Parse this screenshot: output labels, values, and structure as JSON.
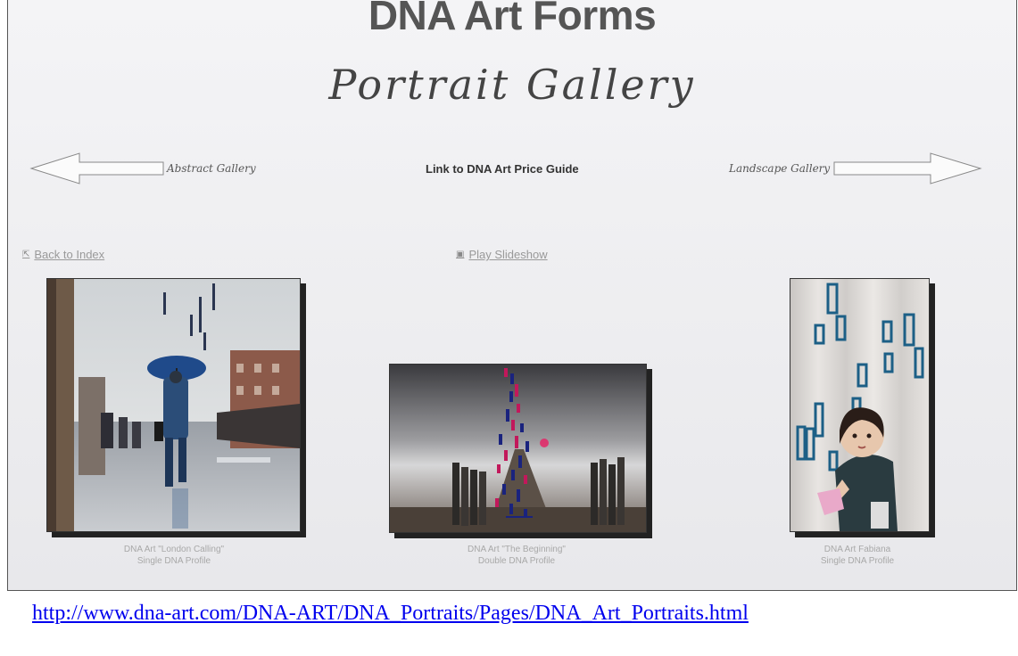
{
  "header": {
    "site_title": "DNA Art Forms",
    "page_title": "Portrait Gallery"
  },
  "nav": {
    "prev_label": "Abstract Gallery",
    "next_label": "Landscape Gallery",
    "price_link": "Link to DNA Art Price Guide",
    "back_link": "Back to Index",
    "slideshow_link": "Play Slideshow",
    "back_icon": "arrow-up-left-icon",
    "slideshow_icon": "slideshow-icon"
  },
  "gallery": [
    {
      "title": "DNA Art \"London Calling\"",
      "subtitle": "Single DNA Profile"
    },
    {
      "title": "DNA Art \"The Beginning\"",
      "subtitle": "Double DNA Profile"
    },
    {
      "title": "DNA Art Fabiana",
      "subtitle": "Single DNA Profile"
    }
  ],
  "footer": {
    "url": "http://www.dna-art.com/DNA-ART/DNA_Portraits/Pages/DNA_Art_Portraits.html"
  },
  "colors": {
    "link": "#0000ee",
    "caption": "#a8a8a8",
    "background": "#f0f0f2"
  }
}
